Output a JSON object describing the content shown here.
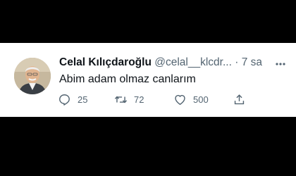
{
  "tweet": {
    "author_name": "Celal Kılıçdaroğlu",
    "handle": "@celal__klcdr...",
    "separator": "·",
    "time": "7 sa",
    "text": "Abim adam olmaz canlarım",
    "reply_count": "25",
    "retweet_count": "72",
    "like_count": "500"
  },
  "colors": {
    "background": "#000000",
    "card": "#ffffff",
    "text_primary": "#0f1419",
    "text_secondary": "#536471"
  },
  "icons": [
    "avatar-photo",
    "more-icon",
    "reply-icon",
    "retweet-icon",
    "like-icon",
    "share-icon"
  ]
}
